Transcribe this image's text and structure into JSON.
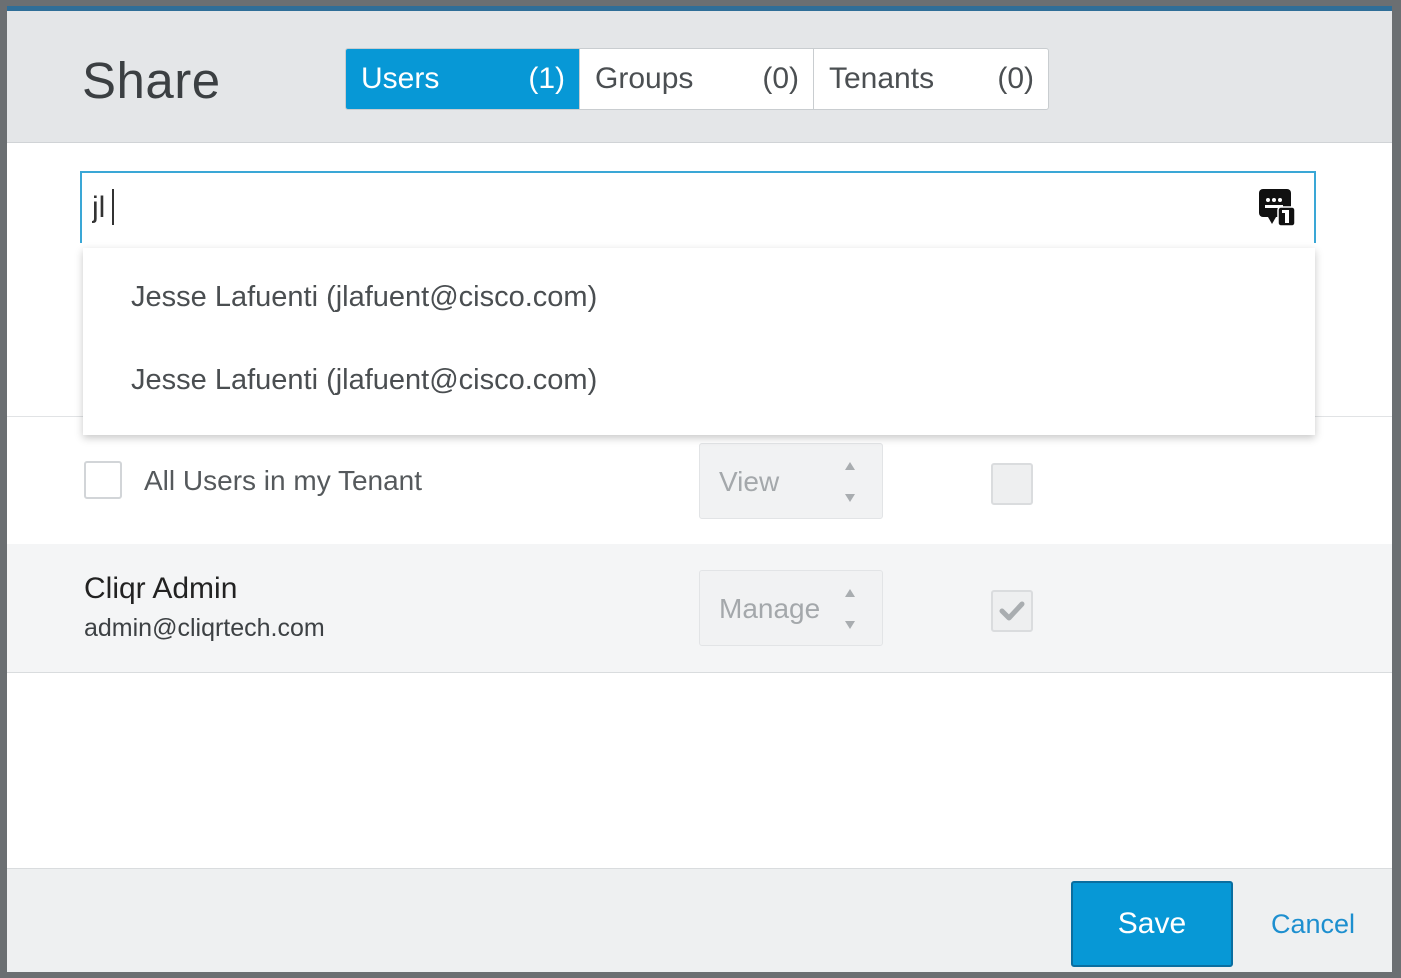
{
  "dialog": {
    "title": "Share",
    "tabs": [
      {
        "label": "Users",
        "count": "(1)",
        "active": true
      },
      {
        "label": "Groups",
        "count": "(0)",
        "active": false
      },
      {
        "label": "Tenants",
        "count": "(0)",
        "active": false
      }
    ]
  },
  "search": {
    "value": "jl",
    "icon": "id-badge-icon"
  },
  "suggestions": [
    "Jesse Lafuenti (jlafuent@cisco.com)",
    "Jesse Lafuenti (jlafuent@cisco.com)"
  ],
  "rows": {
    "all_users": {
      "label": "All Users in my Tenant",
      "permission": "View",
      "checked": false
    },
    "admin": {
      "name": "Cliqr Admin",
      "email": "admin@cliqrtech.com",
      "permission": "Manage",
      "checked": true
    }
  },
  "footer": {
    "save_label": "Save",
    "cancel_label": "Cancel"
  },
  "colors": {
    "accent": "#0798d6",
    "link": "#1d8fcf"
  }
}
